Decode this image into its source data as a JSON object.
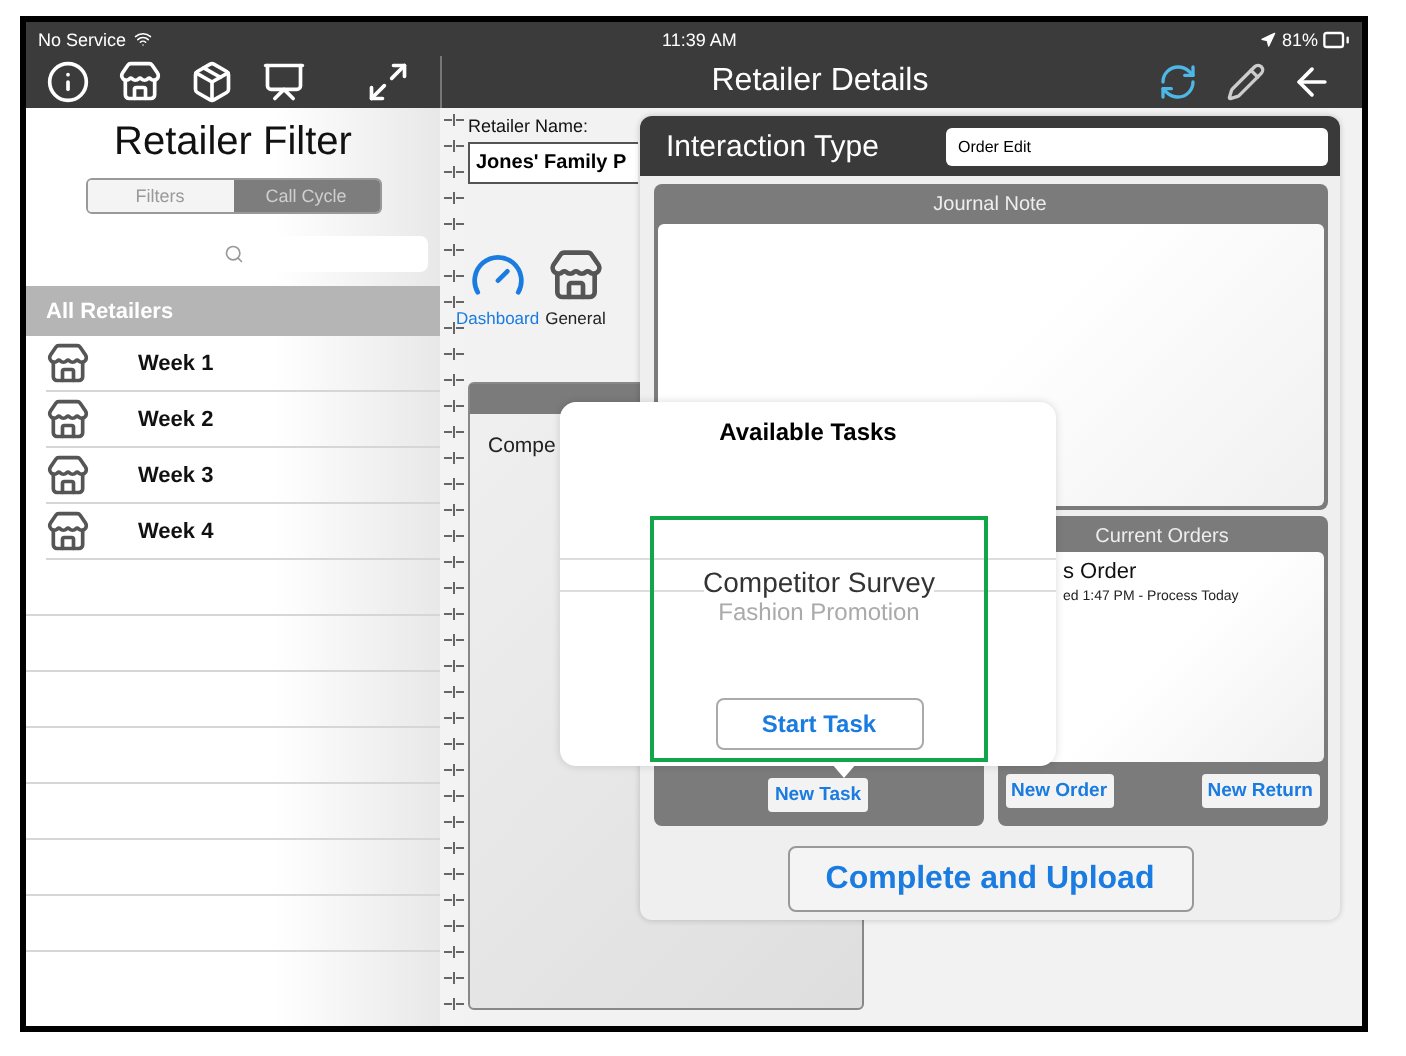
{
  "status_bar": {
    "carrier": "No Service",
    "time": "11:39 AM",
    "battery": "81%"
  },
  "toolbar": {
    "title": "Retailer Details"
  },
  "sidebar": {
    "title": "Retailer Filter",
    "segments": [
      {
        "label": "Filters",
        "selected": false
      },
      {
        "label": "Call Cycle",
        "selected": true
      }
    ],
    "section": "All Retailers",
    "items": [
      {
        "label": "Week 1"
      },
      {
        "label": "Week 2"
      },
      {
        "label": "Week 3"
      },
      {
        "label": "Week 4"
      }
    ]
  },
  "retailer": {
    "name_label": "Retailer Name:",
    "name": "Jones' Family P",
    "nav": [
      {
        "label": "Dashboard",
        "kind": "dashboard",
        "selected": true
      },
      {
        "label": "General",
        "kind": "store",
        "selected": false
      }
    ],
    "card_text": "Compe"
  },
  "interaction": {
    "title": "Interaction Type",
    "type": "Order Edit",
    "journal_title": "Journal Note",
    "task_button": "New Task",
    "orders_title": "Current Orders",
    "orders": [
      {
        "title": "s Order",
        "detail": "ed 1:47 PM - Process Today"
      }
    ],
    "order_buttons": [
      "New Order",
      "New Return"
    ],
    "complete_button": "Complete and Upload"
  },
  "popover": {
    "title": "Available Tasks",
    "tasks": [
      {
        "name": "Competitor Survey",
        "subtitle": "Fashion Promotion",
        "highlighted": true
      }
    ],
    "start_button": "Start Task"
  }
}
